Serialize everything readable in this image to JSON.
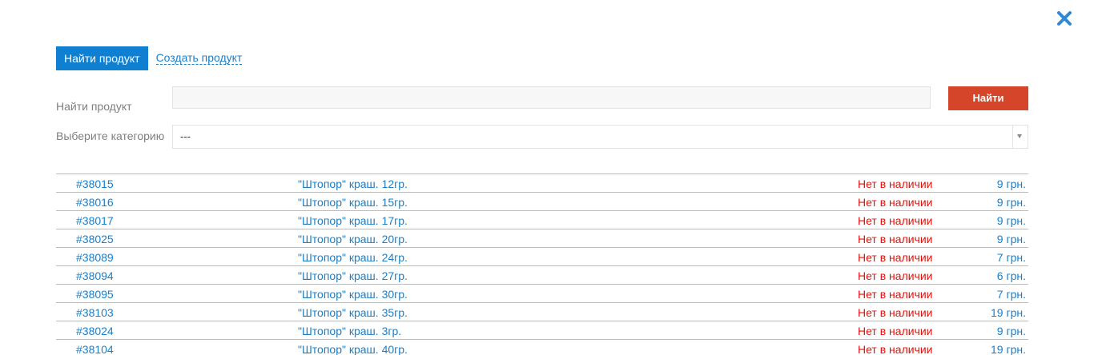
{
  "colors": {
    "accent": "#0f7fd2",
    "link": "#1a7fc8",
    "status_out_of_stock": "#e3120b",
    "search_button": "#d5452a",
    "close_icon": "#2e8ad6"
  },
  "close": {
    "icon": "close-icon"
  },
  "tabs": {
    "active_label": "Найти продукт",
    "create_label": "Создать продукт"
  },
  "search": {
    "label": "Найти продукт",
    "value": "",
    "placeholder": "",
    "button_label": "Найти"
  },
  "category": {
    "label": "Выберите категорию",
    "selected": "---",
    "icon": "chevron-down-icon"
  },
  "products": [
    {
      "id": "#38015",
      "name": "\"Штопор\" краш. 12гр.",
      "status": "Нет в наличии",
      "price": "9 грн."
    },
    {
      "id": "#38016",
      "name": "\"Штопор\" краш. 15гр.",
      "status": "Нет в наличии",
      "price": "9 грн."
    },
    {
      "id": "#38017",
      "name": "\"Штопор\" краш. 17гр.",
      "status": "Нет в наличии",
      "price": "9 грн."
    },
    {
      "id": "#38025",
      "name": "\"Штопор\" краш. 20гр.",
      "status": "Нет в наличии",
      "price": "9 грн."
    },
    {
      "id": "#38089",
      "name": "\"Штопор\" краш. 24гр.",
      "status": "Нет в наличии",
      "price": "7 грн."
    },
    {
      "id": "#38094",
      "name": "\"Штопор\" краш. 27гр.",
      "status": "Нет в наличии",
      "price": "6 грн."
    },
    {
      "id": "#38095",
      "name": "\"Штопор\" краш. 30гр.",
      "status": "Нет в наличии",
      "price": "7 грн."
    },
    {
      "id": "#38103",
      "name": "\"Штопор\" краш. 35гр.",
      "status": "Нет в наличии",
      "price": "19 грн."
    },
    {
      "id": "#38024",
      "name": "\"Штопор\" краш. 3гр.",
      "status": "Нет в наличии",
      "price": "9 грн."
    },
    {
      "id": "#38104",
      "name": "\"Штопор\" краш. 40гр.",
      "status": "Нет в наличии",
      "price": "19 грн."
    }
  ]
}
